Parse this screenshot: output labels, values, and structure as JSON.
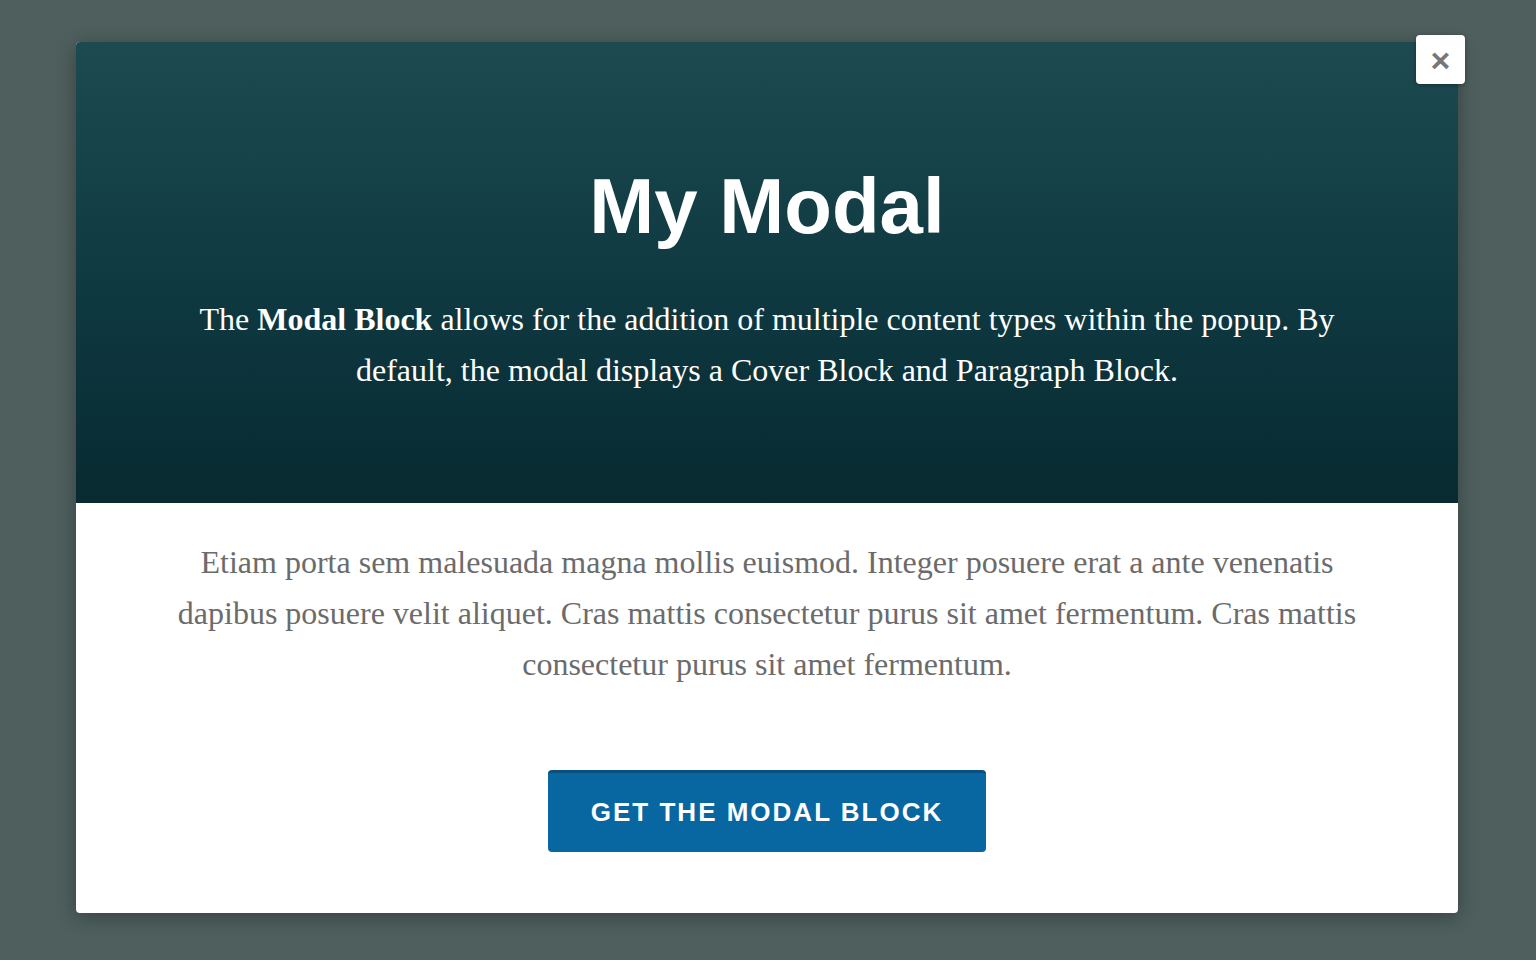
{
  "modal": {
    "close": "×",
    "title": "My Modal",
    "cover_text": [
      {
        "text": "The ",
        "bold": false
      },
      {
        "text": "Modal Block",
        "bold": true
      },
      {
        "text": " allows for the addition of multiple content types within the popup. By default, the modal displays a Cover Block and Paragraph Block.",
        "bold": false
      }
    ],
    "body": "Etiam porta sem malesuada magna mollis euismod. Integer posuere erat a ante venenatis dapibus posuere velit aliquet. Cras mattis consectetur purus sit amet fermentum. Cras mattis consectetur purus sit amet fermentum.",
    "button": "GET THE MODAL BLOCK"
  }
}
